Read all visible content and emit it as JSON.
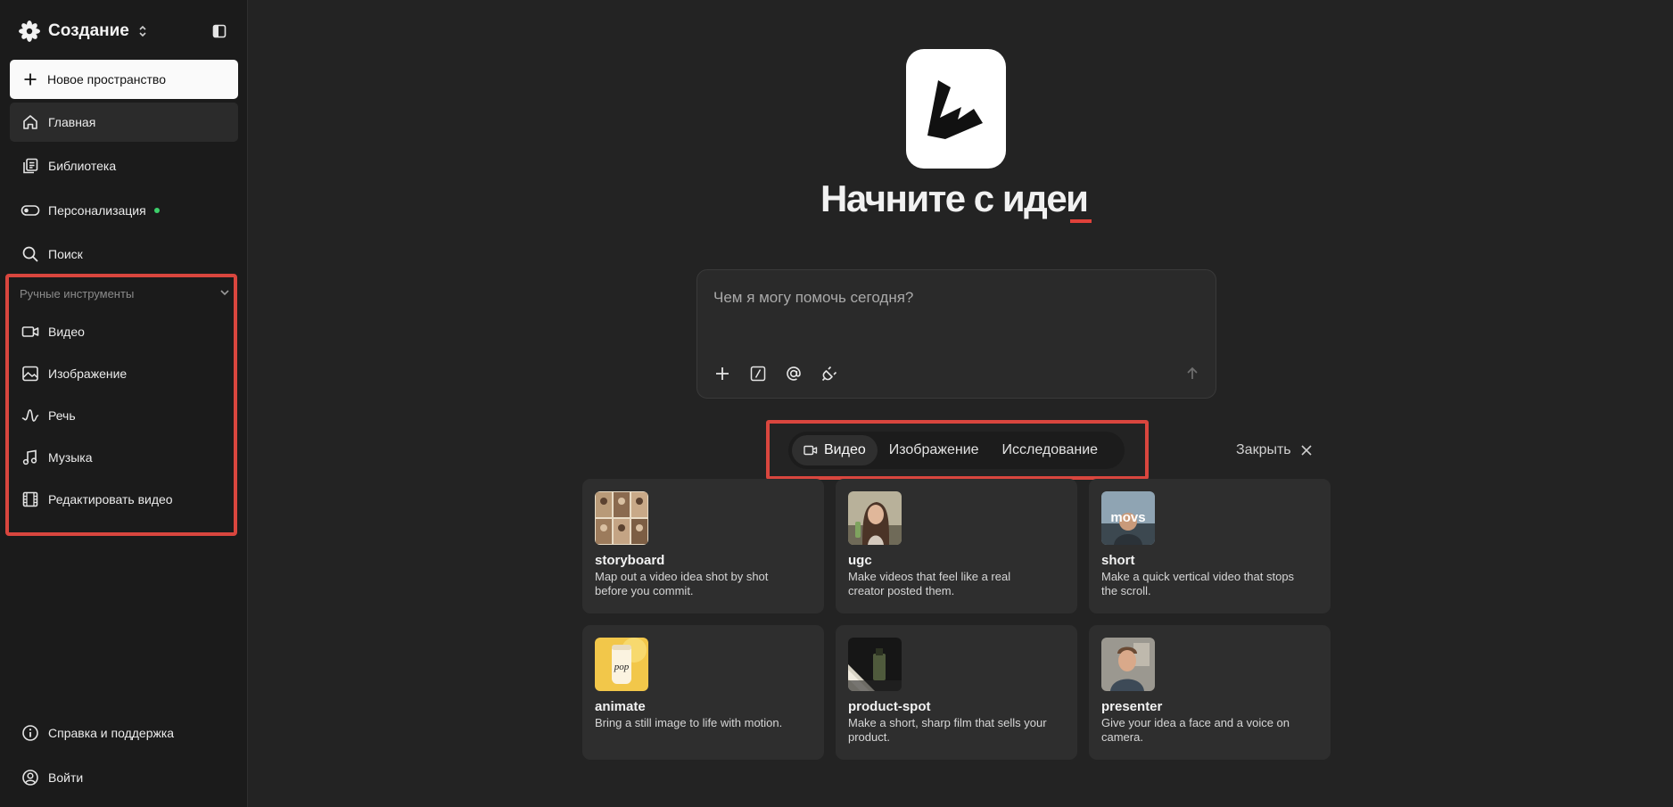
{
  "sidebar": {
    "workspace": "Создание",
    "new_space": "Новое пространство",
    "nav": [
      {
        "label": "Главная",
        "icon": "home-icon"
      },
      {
        "label": "Библиотека",
        "icon": "library-icon"
      },
      {
        "label": "Персонализация",
        "icon": "toggle-icon"
      },
      {
        "label": "Поиск",
        "icon": "search-icon"
      }
    ],
    "tools_header": "Ручные инструменты",
    "tools": [
      {
        "label": "Видео",
        "icon": "video-icon"
      },
      {
        "label": "Изображение",
        "icon": "image-icon"
      },
      {
        "label": "Речь",
        "icon": "wave-icon"
      },
      {
        "label": "Музыка",
        "icon": "music-icon"
      },
      {
        "label": "Редактировать видео",
        "icon": "film-icon"
      }
    ],
    "bottom": [
      {
        "label": "Справка и поддержка",
        "icon": "info-icon"
      },
      {
        "label": "Войти",
        "icon": "user-icon"
      }
    ]
  },
  "main": {
    "headline": "Начните с идеи",
    "prompt_placeholder": "Чем я могу помочь сегодня?",
    "modes": [
      "Видео",
      "Изображение",
      "Исследование"
    ],
    "active_mode": "Видео",
    "close_label": "Закрыть",
    "cards": [
      {
        "title": "storyboard",
        "desc": "Map out a video idea shot by shot before you commit."
      },
      {
        "title": "ugc",
        "desc": "Make videos that feel like a real creator posted them."
      },
      {
        "title": "short",
        "desc": "Make a quick vertical video that stops the scroll."
      },
      {
        "title": "animate",
        "desc": "Bring a still image to life with motion."
      },
      {
        "title": "product-spot",
        "desc": "Make a short, sharp film that sells your product."
      },
      {
        "title": "presenter",
        "desc": "Give your idea a face and a voice on camera."
      }
    ],
    "thumb_texts": {
      "short": "movs",
      "animate": "pop"
    }
  },
  "colors": {
    "background": "#232323",
    "sidebar": "#1b1b1b",
    "highlight_border": "#d9463e",
    "cursor_accent": "#e0413a",
    "status_dot": "#3ccf6a"
  }
}
